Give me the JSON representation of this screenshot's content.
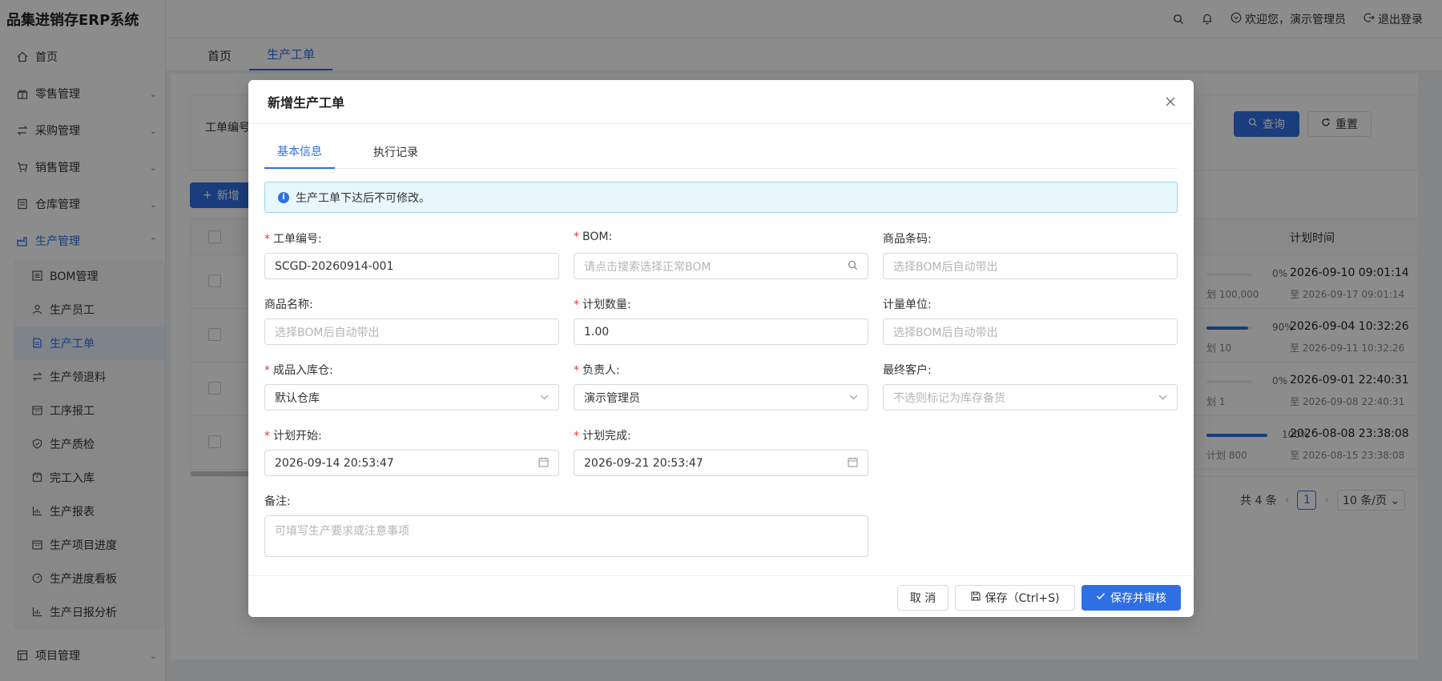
{
  "app_title": "品集进销存ERP系统",
  "sidebar": {
    "items": [
      {
        "label": "首页",
        "icon": "home-icon"
      },
      {
        "label": "零售管理",
        "icon": "gift-icon"
      },
      {
        "label": "采购管理",
        "icon": "exchange-icon"
      },
      {
        "label": "销售管理",
        "icon": "cart-icon"
      },
      {
        "label": "仓库管理",
        "icon": "warehouse-icon"
      },
      {
        "label": "生产管理",
        "icon": "factory-icon"
      }
    ],
    "sub_items": [
      {
        "label": "BOM管理"
      },
      {
        "label": "生产员工"
      },
      {
        "label": "生产工单"
      },
      {
        "label": "生产领退料"
      },
      {
        "label": "工序报工"
      },
      {
        "label": "生产质检"
      },
      {
        "label": "完工入库"
      },
      {
        "label": "生产报表"
      },
      {
        "label": "生产项目进度"
      },
      {
        "label": "生产进度看板"
      },
      {
        "label": "生产日报分析"
      }
    ],
    "bottom_item": {
      "label": "项目管理"
    }
  },
  "header": {
    "welcome": "欢迎您，演示管理员",
    "logout": "退出登录"
  },
  "tabs": {
    "home": "首页",
    "work_order": "生产工单"
  },
  "search": {
    "label": "工单编号",
    "query": "查询",
    "reset": "重置"
  },
  "add_button": "新增",
  "table": {
    "header_time": "计划时间",
    "rows": [
      {
        "pct": "0%",
        "progress": 0,
        "plan": "划 100,000",
        "start": "2026-09-10 09:01:14",
        "end": "至 2026-09-17 09:01:14"
      },
      {
        "pct": "90%",
        "progress": 90,
        "plan": "划 10",
        "start": "2026-09-04 10:32:26",
        "end": "至 2026-09-11 10:32:26"
      },
      {
        "pct": "0%",
        "progress": 0,
        "plan": "划 1",
        "start": "2026-09-01 22:40:31",
        "end": "至 2026-09-08 22:40:31"
      },
      {
        "pct": "100%",
        "progress": 100,
        "plan": "计划 800",
        "start": "2026-08-08 23:38:08",
        "end": "至 2026-08-15 23:38:08"
      }
    ]
  },
  "pager": {
    "total": "共 4 条",
    "page": "1",
    "size": "10 条/页"
  },
  "modal": {
    "title": "新增生产工单",
    "tab_basic": "基本信息",
    "tab_log": "执行记录",
    "alert": "生产工单下达后不可修改。",
    "fields": {
      "order_no": {
        "label": "工单编号:",
        "value": "SCGD-20260914-001"
      },
      "bom": {
        "label": "BOM:",
        "placeholder": "请点击搜索选择正常BOM"
      },
      "barcode": {
        "label": "商品条码:",
        "placeholder": "选择BOM后自动带出"
      },
      "product_name": {
        "label": "商品名称:",
        "placeholder": "选择BOM后自动带出"
      },
      "plan_qty": {
        "label": "计划数量:",
        "value": "1.00"
      },
      "unit": {
        "label": "计量单位:",
        "placeholder": "选择BOM后自动带出"
      },
      "warehouse": {
        "label": "成品入库仓:",
        "value": "默认仓库"
      },
      "owner": {
        "label": "负责人:",
        "value": "演示管理员"
      },
      "customer": {
        "label": "最终客户:",
        "placeholder": "不选则标记为库存备货"
      },
      "plan_start": {
        "label": "计划开始:",
        "value": "2026-09-14 20:53:47"
      },
      "plan_end": {
        "label": "计划完成:",
        "value": "2026-09-21 20:53:47"
      },
      "remark": {
        "label": "备注:",
        "placeholder": "可填写生产要求或注意事项"
      }
    },
    "buttons": {
      "cancel": "取 消",
      "save": "保存（Ctrl+S)",
      "save_audit": "保存并审核"
    }
  },
  "colors": {
    "primary": "#2f6fe4",
    "required": "#e53935"
  }
}
